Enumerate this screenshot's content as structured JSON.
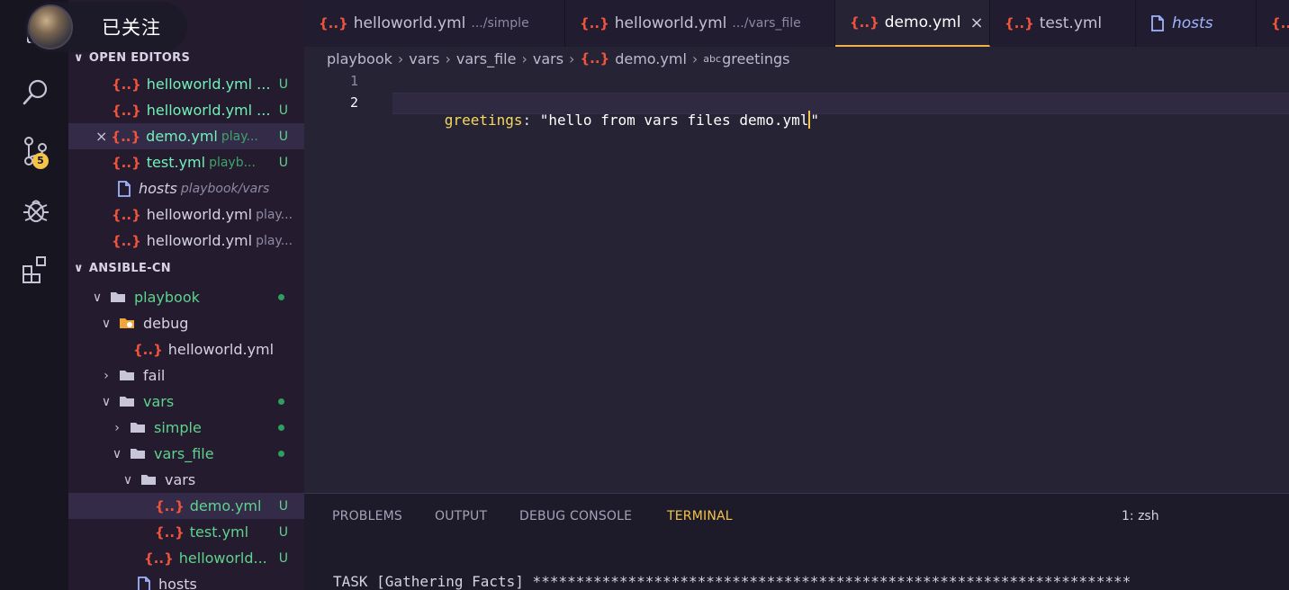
{
  "follow_overlay": {
    "label": "已关注"
  },
  "activity_bar": {
    "icons": [
      "explorer-icon",
      "search-icon",
      "source-control-icon",
      "debug-icon",
      "extensions-icon"
    ],
    "source_control_badge": "5"
  },
  "sidebar": {
    "open_editors": {
      "title": "OPEN EDITORS",
      "items": [
        {
          "icon": "{..}",
          "name": "helloworld.yml ...",
          "detail": "",
          "status": "U"
        },
        {
          "icon": "{..}",
          "name": "helloworld.yml ...",
          "detail": "",
          "status": "U"
        },
        {
          "icon": "{..}",
          "name": "demo.yml",
          "detail": "play...",
          "status": "U"
        },
        {
          "icon": "{..}",
          "name": "test.yml",
          "detail": "playb...",
          "status": "U"
        },
        {
          "icon": "file",
          "name": "hosts",
          "detail": "playbook/vars",
          "status": ""
        },
        {
          "icon": "{..}",
          "name": "helloworld.yml",
          "detail": "play...",
          "status": ""
        },
        {
          "icon": "{..}",
          "name": "helloworld.yml",
          "detail": "play...",
          "status": ""
        }
      ]
    },
    "workspace": {
      "title": "ANSIBLE-CN",
      "tree": [
        {
          "name": "playbook",
          "status": "dot"
        },
        {
          "name": "debug",
          "status": ""
        },
        {
          "name": "helloworld.yml",
          "status": ""
        },
        {
          "name": "fail",
          "status": ""
        },
        {
          "name": "vars",
          "status": "dot"
        },
        {
          "name": "simple",
          "status": "dot"
        },
        {
          "name": "vars_file",
          "status": "dot"
        },
        {
          "name": "vars",
          "status": ""
        },
        {
          "name": "demo.yml",
          "status": "U"
        },
        {
          "name": "test.yml",
          "status": "U"
        },
        {
          "name": "helloworld...",
          "status": "U"
        },
        {
          "name": "hosts",
          "status": ""
        }
      ]
    }
  },
  "tabs": [
    {
      "name": "helloworld.yml",
      "path": ".../simple"
    },
    {
      "name": "helloworld.yml",
      "path": ".../vars_file"
    },
    {
      "name": "demo.yml",
      "path": "",
      "active": true
    },
    {
      "name": "test.yml",
      "path": ""
    },
    {
      "name": "hosts",
      "path": ""
    }
  ],
  "tab_icon": "{..}",
  "close_glyph": "×",
  "breadcrumb": {
    "parts": [
      "playbook",
      "vars",
      "vars_file",
      "vars"
    ],
    "file": "demo.yml",
    "symbol_prefix": "abc",
    "symbol": "greetings"
  },
  "editor": {
    "line_numbers": [
      "1",
      "2"
    ],
    "code": {
      "key": "greetings",
      "colon": ": ",
      "value": "\"hello from vars files demo.yml",
      "closing_quote": "\""
    }
  },
  "panel": {
    "tabs": [
      "PROBLEMS",
      "OUTPUT",
      "DEBUG CONSOLE",
      "TERMINAL"
    ],
    "active_tab": "TERMINAL",
    "shell": "1: zsh",
    "terminal_text": "TASK [Gathering Facts] *********************************************************************"
  },
  "colors": {
    "accent": "#f4c44a",
    "yml_icon": "#f0543c",
    "untracked_green": "#72f1b8",
    "editor_bg": "#262335"
  }
}
